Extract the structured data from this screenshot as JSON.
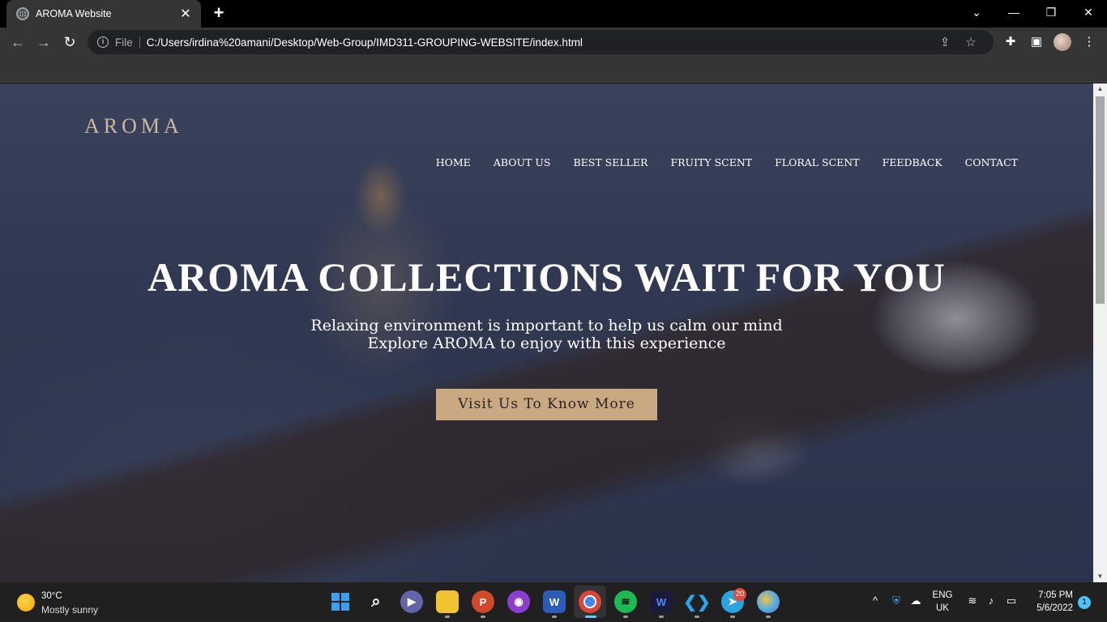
{
  "browser": {
    "tab_title": "AROMA Website",
    "tab_close": "✕",
    "new_tab": "+",
    "file_label": "File",
    "url": "C:/Users/irdina%20amani/Desktop/Web-Group/IMD311-GROUPING-WEBSITE/index.html"
  },
  "site": {
    "logo": "AROMA",
    "nav": [
      "HOME",
      "ABOUT US",
      "BEST SELLER",
      "FRUITY SCENT",
      "FLORAL SCENT",
      "FEEDBACK",
      "CONTACT"
    ],
    "hero_title": "AROMA COLLECTIONS WAIT FOR YOU",
    "hero_line1": "Relaxing environment is important to help us calm our mind",
    "hero_line2": "Explore AROMA to enjoy with this experience",
    "cta_label": "Visit Us To Know More"
  },
  "taskbar": {
    "weather_temp": "30°C",
    "weather_desc": "Mostly sunny",
    "lang_top": "ENG",
    "lang_bottom": "UK",
    "time": "7:05 PM",
    "date": "5/6/2022",
    "telegram_badge": "20",
    "notification_count": "1"
  },
  "colors": {
    "cta_background": "#c8a981",
    "logo": "#c9b8a0",
    "chrome_bg": "#353535"
  }
}
